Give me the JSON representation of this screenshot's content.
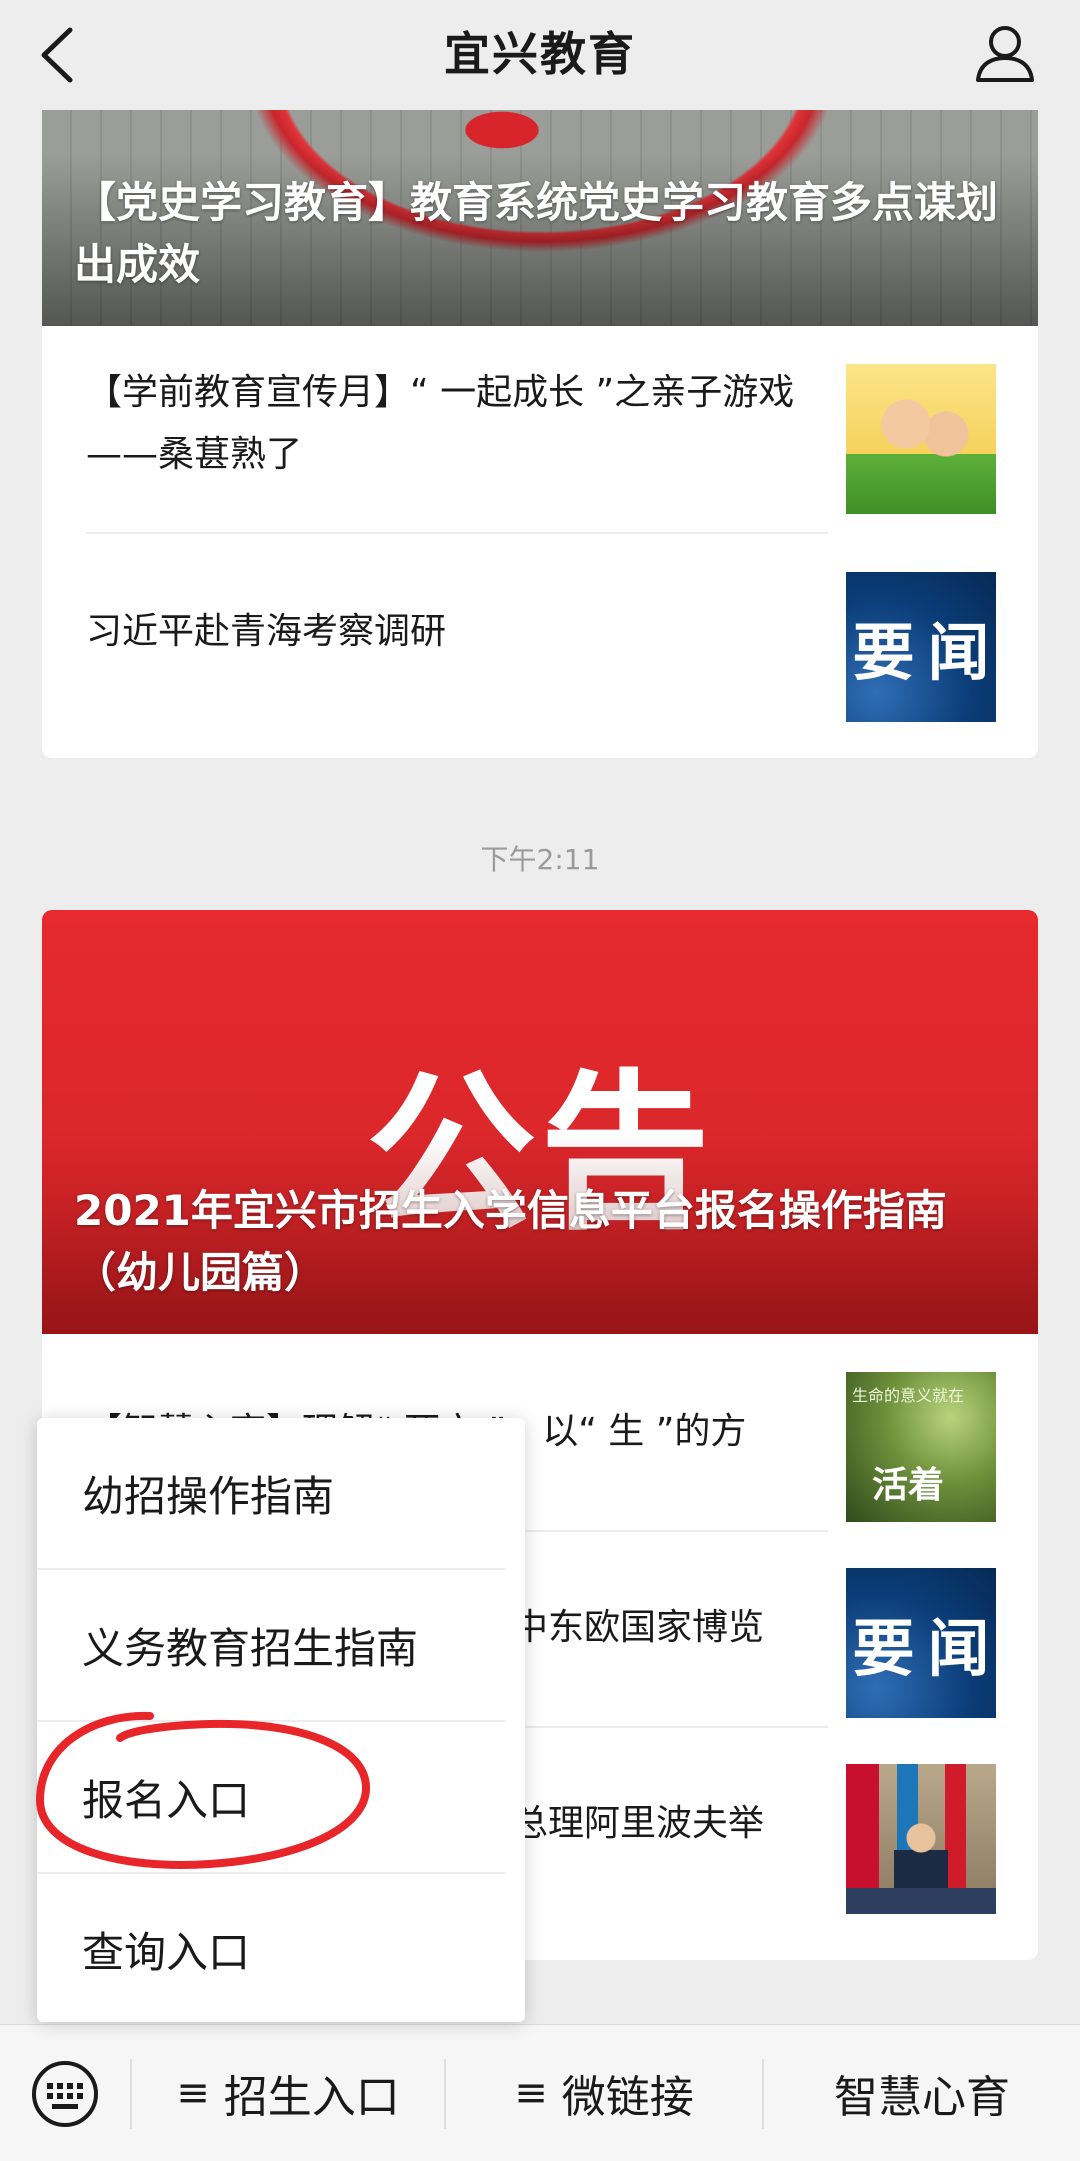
{
  "header": {
    "title": "宜兴教育"
  },
  "feed1": {
    "cover_title": "【党史学习教育】教育系统党史学习教育多点谋划出成效",
    "items": [
      {
        "text": "【学前教育宣传月】“ 一起成长 ”之亲子游戏——桑葚熟了",
        "thumb": "kids-illustration"
      },
      {
        "text": "习近平赴青海考察调研",
        "thumb": "news-banner",
        "thumb_text": [
          "要",
          "闻"
        ]
      }
    ]
  },
  "timestamp": "下午2:11",
  "feed2": {
    "cover_big_text": "公告",
    "cover_title": "2021年宜兴市招生入学信息平台报名操作指南（幼儿园篇）",
    "items": [
      {
        "text": "【智慧心育】理解“ 死亡 ”，以“ 生 ”的方",
        "thumb": "life-image",
        "thumb_small": "生命的意义就在",
        "thumb_big": "活着"
      },
      {
        "text": "中东欧国家博览",
        "thumb": "news-banner",
        "thumb_text": [
          "要",
          "闻"
        ]
      },
      {
        "text": "总理阿里波夫举",
        "thumb": "meeting-photo"
      }
    ]
  },
  "popup_menu": {
    "items": [
      "幼招操作指南",
      "义务教育招生指南",
      "报名入口",
      "查询入口"
    ],
    "highlighted": "报名入口"
  },
  "tabbar": {
    "tabs": [
      {
        "label": "招生入口",
        "icon": "menu-icon"
      },
      {
        "label": "微链接",
        "icon": "menu-icon"
      },
      {
        "label": "智慧心育"
      }
    ]
  },
  "colors": {
    "accent_red": "#d8262a",
    "annotation_red": "#e8262a",
    "background": "#ededed"
  }
}
